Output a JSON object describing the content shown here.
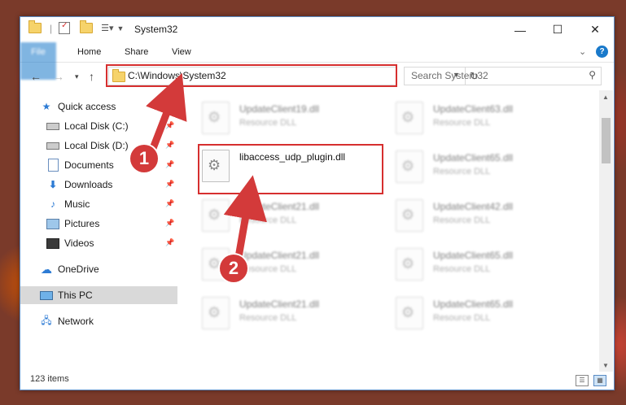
{
  "window": {
    "title": "System32",
    "controls": {
      "minimize": "—",
      "maximize": "☐",
      "close": "✕"
    }
  },
  "ribbon": {
    "tabs": [
      "File",
      "Home",
      "Share",
      "View"
    ],
    "expand": "⌄",
    "help": "?"
  },
  "navigation": {
    "address": "C:\\Windows\\System32",
    "search_placeholder": "Search System32"
  },
  "sidebar": {
    "items": [
      {
        "label": "Quick access",
        "icon": "star-icon"
      },
      {
        "label": "Local Disk (C:)",
        "icon": "drive-icon"
      },
      {
        "label": "Local Disk (D:)",
        "icon": "drive-icon"
      },
      {
        "label": "Documents",
        "icon": "documents-icon"
      },
      {
        "label": "Downloads",
        "icon": "download-icon"
      },
      {
        "label": "Music",
        "icon": "music-icon"
      },
      {
        "label": "Pictures",
        "icon": "pictures-icon"
      },
      {
        "label": "Videos",
        "icon": "videos-icon"
      },
      {
        "label": "OneDrive",
        "icon": "cloud-icon"
      },
      {
        "label": "This PC",
        "icon": "computer-icon"
      },
      {
        "label": "Network",
        "icon": "network-icon"
      }
    ]
  },
  "files": {
    "col1": [
      {
        "name": "UpdateClient19.dll",
        "type": "Resource DLL"
      },
      {
        "name": "libaccess_udp_plugin.dll",
        "type": ""
      },
      {
        "name": "UpdateClient21.dll",
        "type": "Resource DLL"
      },
      {
        "name": "UpdateClient21.dll",
        "type": "Resource DLL"
      },
      {
        "name": "UpdateClient21.dll",
        "type": "Resource DLL"
      }
    ],
    "col2": [
      {
        "name": "UpdateClient63.dll",
        "type": "Resource DLL"
      },
      {
        "name": "UpdateClient65.dll",
        "type": "Resource DLL"
      },
      {
        "name": "UpdateClient42.dll",
        "type": "Resource DLL"
      },
      {
        "name": "UpdateClient65.dll",
        "type": "Resource DLL"
      },
      {
        "name": "UpdateClient65.dll",
        "type": "Resource DLL"
      }
    ]
  },
  "status": {
    "count": "123 items"
  },
  "annotations": {
    "badge1": "1",
    "badge2": "2"
  },
  "colors": {
    "accent": "#1979ca",
    "highlight": "#d62f2f"
  }
}
